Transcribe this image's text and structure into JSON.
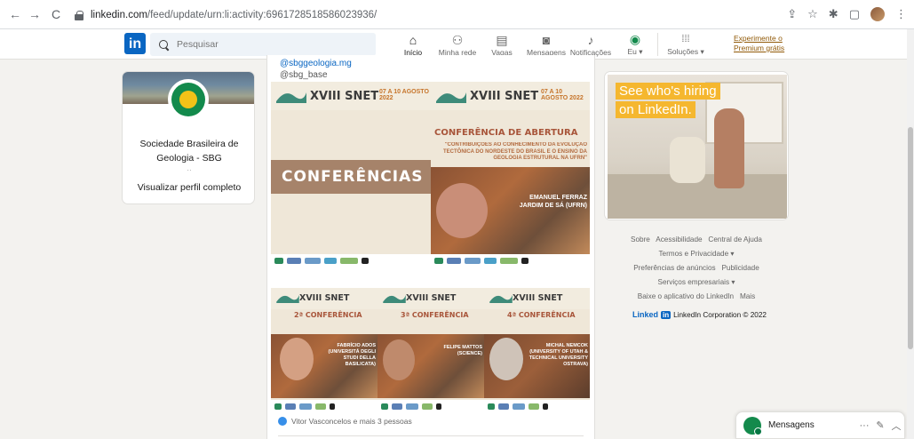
{
  "browser": {
    "url_host": "linkedin.com",
    "url_path": "/feed/update/urn:li:activity:6961728518586023936/",
    "nav": {
      "back": "←",
      "forward": "→",
      "reload": "C"
    },
    "right_icons": [
      "share-icon",
      "star-icon",
      "extension-icon",
      "sidepanel-icon",
      "profile-avatar",
      "menu-icon"
    ]
  },
  "header": {
    "logo": "in",
    "search_placeholder": "Pesquisar",
    "nav": [
      {
        "label": "Início",
        "icon": "home-icon",
        "glyph": "⌂",
        "active": true
      },
      {
        "label": "Minha rede",
        "icon": "network-icon",
        "glyph": "👥",
        "active": false
      },
      {
        "label": "Vagas",
        "icon": "briefcase-icon",
        "glyph": "💼",
        "active": false
      },
      {
        "label": "Mensagens",
        "icon": "message-icon",
        "glyph": "💬",
        "active": false
      },
      {
        "label": "Notificações",
        "icon": "bell-icon",
        "glyph": "🔔",
        "active": false
      },
      {
        "label": "Eu ▾",
        "icon": "me-avatar",
        "glyph": "◉",
        "active": false
      },
      {
        "label": "Soluções ▾",
        "icon": "grid-icon",
        "glyph": "⋮⋮⋮",
        "active": false
      }
    ],
    "premium_line1": "Experimente o",
    "premium_line2": "Premium grátis"
  },
  "profile": {
    "name_line1": "Sociedade Brasileira de",
    "name_line2": "Geologia - SBG",
    "dots": "··",
    "view_label": "Visualizar perfil completo"
  },
  "feed": {
    "mention1": "@sbggeologia.mg",
    "mention2": "@sbg_base",
    "poster": {
      "snet": "XVIII SNET",
      "date": "07 A 10 AGOSTO 2022",
      "conf_label": "CONFERÊNCIAS",
      "abertura": "CONFERÊNCIA DE ABERTURA",
      "abertura_sub": "\"CONTRIBUIÇÕES AO CONHECIMENTO DA EVOLUÇÃO TECTÔNICA DO NORDESTE DO BRASIL E O ENSINO DA GEOLOGIA ESTRUTURAL NA UFRN\"",
      "speaker": "EMANUEL FERRAZ JARDIM DE SÁ (UFRN)",
      "conf2": "2ª CONFERÊNCIA",
      "conf3": "3ª CONFERÊNCIA",
      "conf4": "4ª CONFERÊNCIA",
      "speaker2": "FABRÍCIO ADOS (UNIVERSITÁ DEGLI STUDI DELLA BASILICATA)",
      "speaker3": "FELIPE MATTOS (SCIENCE)",
      "speaker4": "MICHAL NEMCOK (UNIVERSITY OF UTAH & TECHNICAL UNIVERSITY OSTRAVA)"
    },
    "reactions": "Vitor Vasconcelos e mais 3 pessoas"
  },
  "ad": {
    "line1": "See who's hiring",
    "line2": "on LinkedIn."
  },
  "footer": {
    "row1": [
      "Sobre",
      "Acessibilidade",
      "Central de Ajuda"
    ],
    "row2": [
      "Termos e Privacidade ▾"
    ],
    "row3": [
      "Preferências de anúncios",
      "Publicidade"
    ],
    "row4": [
      "Serviços empresariais ▾"
    ],
    "row5": [
      "Baixe o aplicativo do LinkedIn",
      "Mais"
    ],
    "brand_text": "Linked",
    "brand_box": "in",
    "copyright": "LinkedIn Corporation © 2022"
  },
  "messaging": {
    "label": "Mensagens",
    "icons": [
      "more-icon",
      "compose-icon",
      "chevron-up-icon"
    ]
  },
  "colors": {
    "brand": "#0a66c2",
    "premium": "#915907",
    "ad_accent": "#f5b72f",
    "sbg_green": "#138a4c"
  }
}
